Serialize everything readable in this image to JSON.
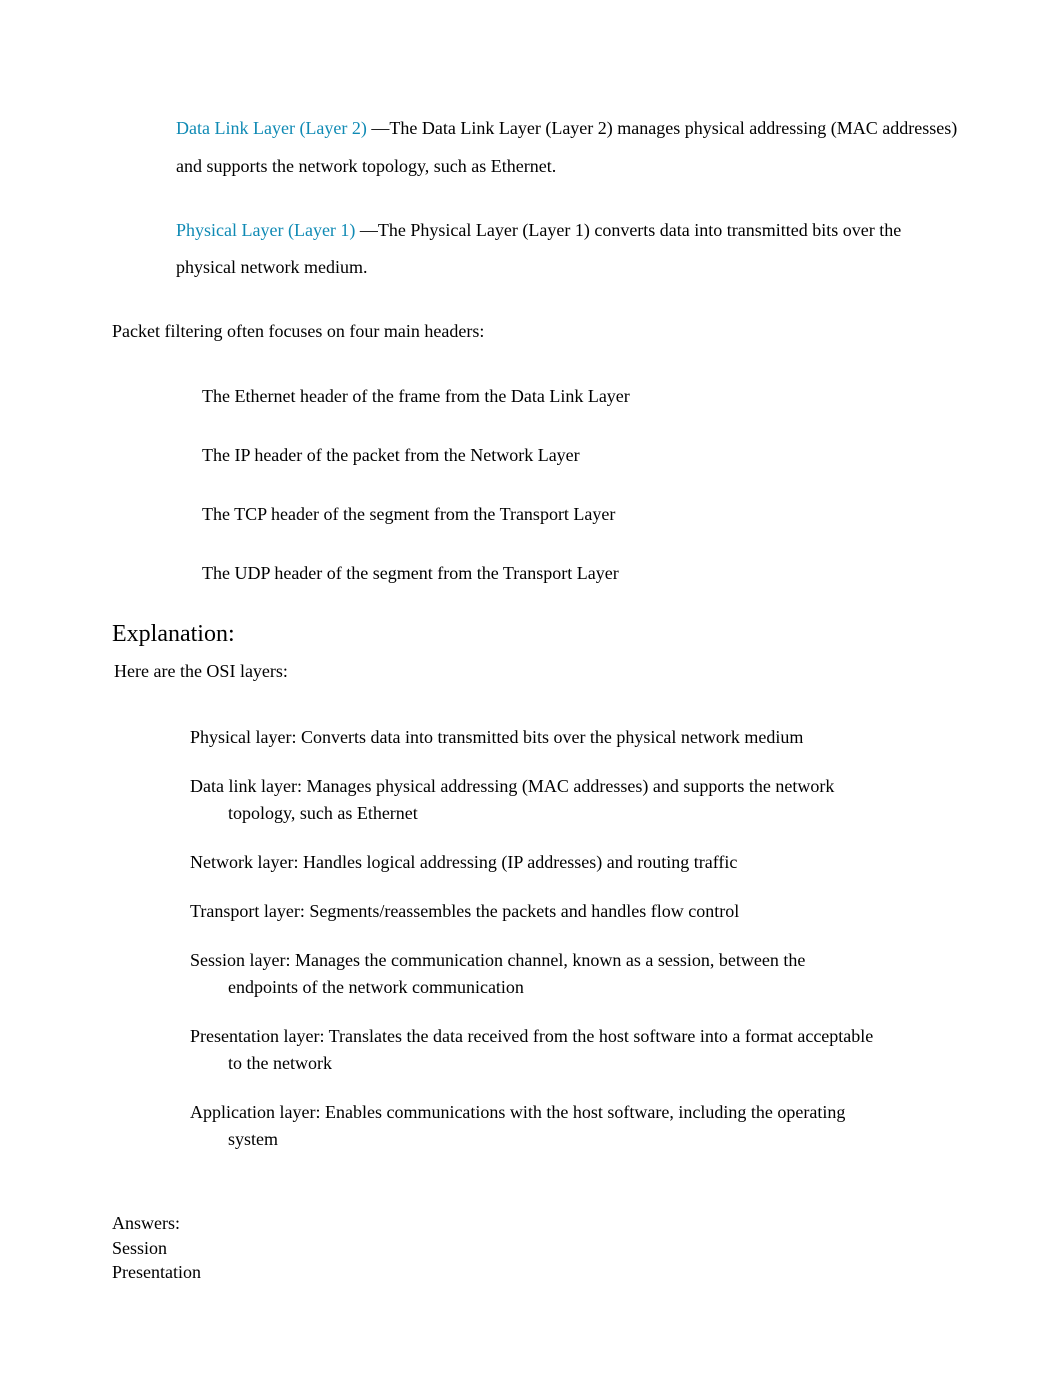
{
  "top_bullets": [
    {
      "link": "Data Link Layer (Layer 2)",
      "dash": " —The ",
      "bold": "Data Link Layer (Layer 2)",
      "rest": " manages physical addressing (MAC addresses) and supports the network topology, such as Ethernet."
    },
    {
      "link": "Physical Layer (Layer 1)",
      "dash": " —The ",
      "bold": "Physical Layer (Layer 1)",
      "rest": " converts data into transmitted bits over the physical network medium."
    }
  ],
  "filter_intro": "Packet filtering often focuses on four main headers:",
  "filter_headers": [
    "The Ethernet header of the frame from the Data Link Layer",
    "The IP header of the packet from the Network Layer",
    "The TCP header of the segment from the Transport Layer",
    "The UDP header of the segment from the Transport Layer"
  ],
  "explanation_heading": "Explanation:",
  "osi_intro": "Here are the OSI layers:",
  "osi_layers": [
    {
      "name": "Physical layer:",
      "desc_first": " Converts data into transmitted bits over the physical network medium",
      "desc_cont": ""
    },
    {
      "name": "Data link layer:",
      "desc_first": " Manages physical addressing (MAC addresses) and supports the network",
      "desc_cont": "topology, such as Ethernet"
    },
    {
      "name": "Network layer:",
      "desc_first": " Handles logical addressing (IP addresses) and routing traffic",
      "desc_cont": ""
    },
    {
      "name": "Transport layer:",
      "desc_first": " Segments/reassembles the packets and handles flow control",
      "desc_cont": ""
    },
    {
      "name": "Session layer:",
      "desc_first": " Manages the communication channel, known as a session, between the",
      "desc_cont": "endpoints of the network communication"
    },
    {
      "name": "Presentation layer:",
      "desc_first": " Translates the data received from the host software into a format acceptable",
      "desc_cont": "to the network"
    },
    {
      "name": "Application layer:",
      "desc_first": " Enables communications with the host software, including the operating",
      "desc_cont": "system"
    }
  ],
  "answers_label": "Answers:",
  "answers": [
    "Session",
    "Presentation"
  ]
}
